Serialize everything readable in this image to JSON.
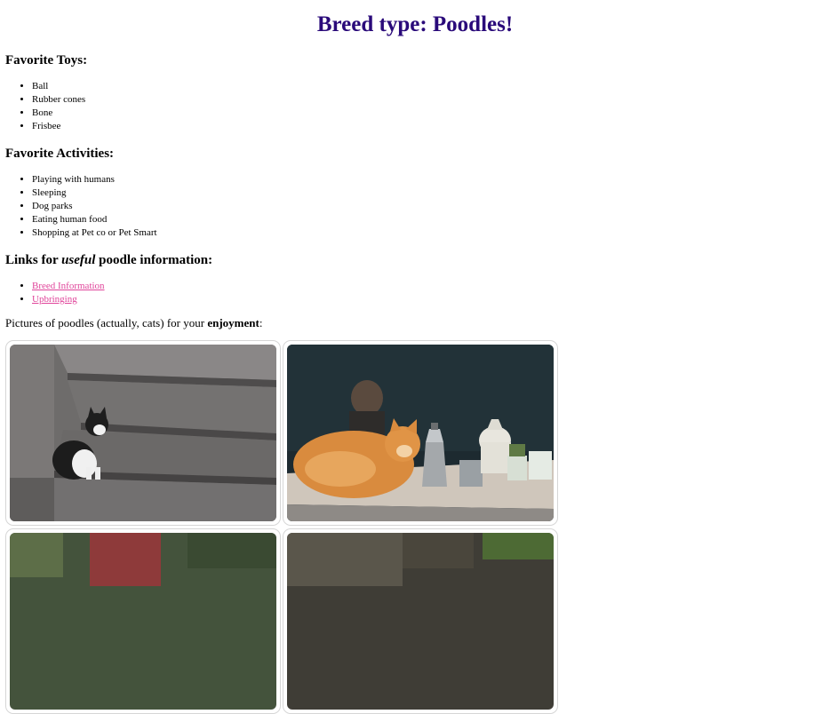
{
  "heading": "Breed type: Poodles!",
  "toys": {
    "heading": "Favorite Toys:",
    "items": [
      "Ball",
      "Rubber cones",
      "Bone",
      "Frisbee"
    ]
  },
  "activities": {
    "heading": "Favorite Activities:",
    "items": [
      "Playing with humans",
      "Sleeping",
      "Dog parks",
      "Eating human food",
      "Shopping at Pet co or Pet Smart"
    ]
  },
  "links": {
    "heading_prefix": "Links for ",
    "heading_emphasis": "useful",
    "heading_suffix": " poodle information:",
    "items": [
      "Breed Information",
      "Upbringing"
    ]
  },
  "pictures": {
    "intro_prefix": "Pictures of poodles (actually, cats) for your ",
    "intro_bold": "enjoyment",
    "intro_suffix": ":"
  },
  "colors": {
    "heading": "#2a0a7a",
    "link": "#e0449a",
    "tile_border": "#d6d6d6"
  }
}
